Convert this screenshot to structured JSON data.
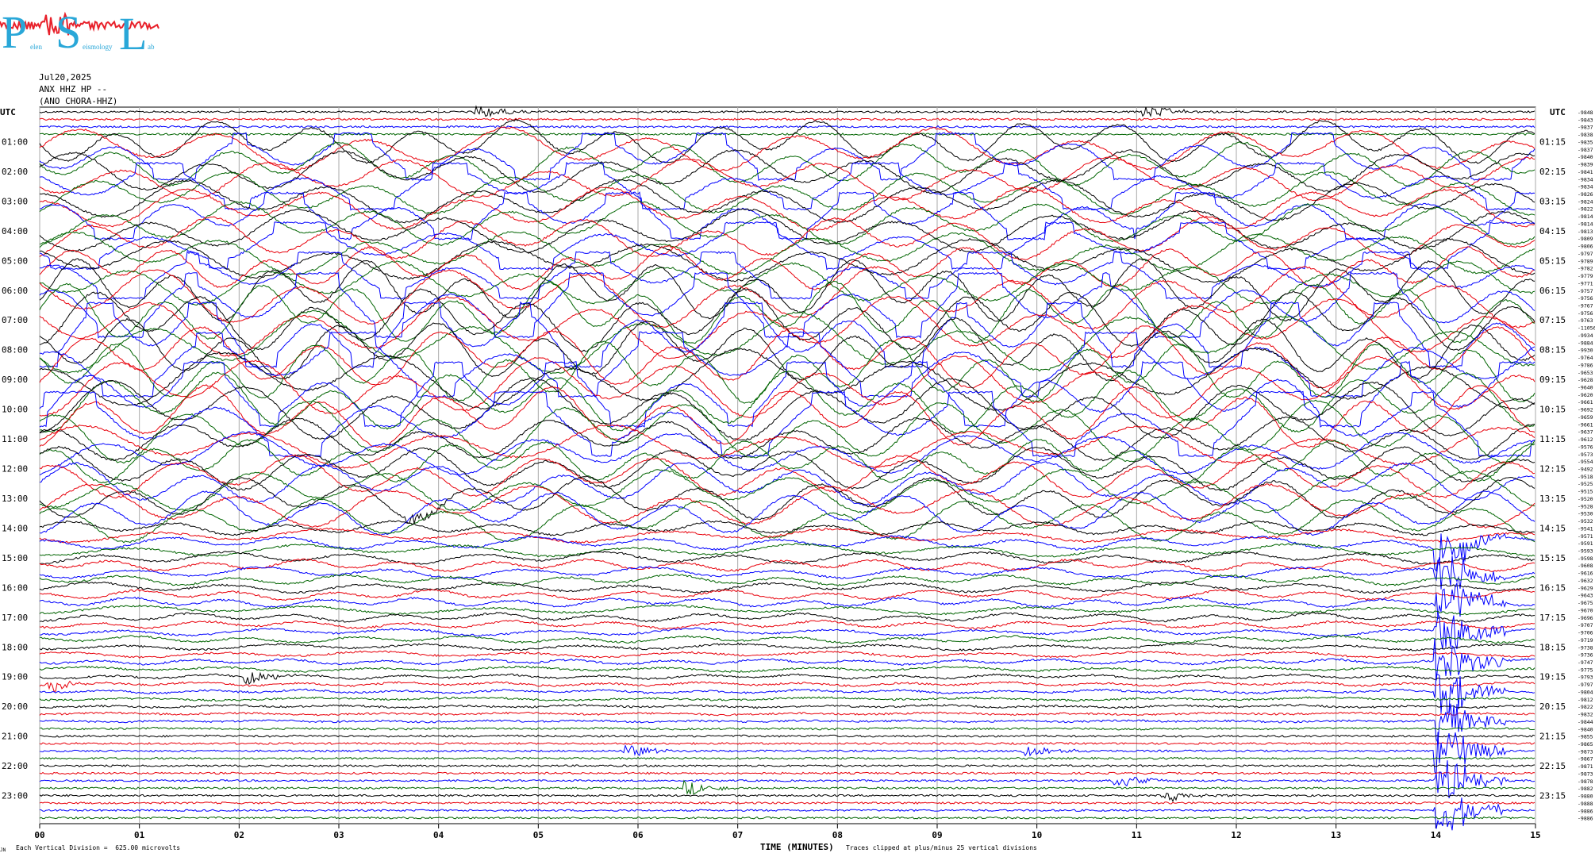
{
  "logo": {
    "initials": [
      "P",
      "S",
      "L"
    ],
    "small_text": [
      "elen",
      "eismology",
      "ab"
    ],
    "colors": {
      "letters": "#29a7d8",
      "trace": "#e8202a"
    }
  },
  "header": {
    "date": "Jul20,2025",
    "station": "ANX HHZ HP --",
    "location": "(ANO CHORA-HHZ)"
  },
  "labels": {
    "utc_left": "UTC",
    "utc_right": "UTC",
    "x_title": "TIME (MINUTES)",
    "scale_note": "Each Vertical Division =  625.00 microvolts",
    "clip_note": "Traces clipped at plus/minus 25 vertical divisions",
    "corner_mark": "JN"
  },
  "chart_data": {
    "type": "line",
    "title": "",
    "xlabel": "TIME (MINUTES)",
    "xlim": [
      0,
      15
    ],
    "x_ticks": [
      "00",
      "01",
      "02",
      "03",
      "04",
      "05",
      "06",
      "07",
      "08",
      "09",
      "10",
      "11",
      "12",
      "13",
      "14",
      "15"
    ],
    "left_hour_labels": [
      "01:00",
      "02:00",
      "03:00",
      "04:00",
      "05:00",
      "06:00",
      "07:00",
      "08:00",
      "09:00",
      "10:00",
      "11:00",
      "12:00",
      "13:00",
      "14:00",
      "15:00",
      "16:00",
      "17:00",
      "18:00",
      "19:00",
      "20:00",
      "21:00",
      "22:00",
      "23:00"
    ],
    "right_hour_labels": [
      "01:15",
      "02:15",
      "03:15",
      "04:15",
      "05:15",
      "06:15",
      "07:15",
      "08:15",
      "09:15",
      "10:15",
      "11:15",
      "12:15",
      "13:15",
      "14:15",
      "15:15",
      "16:15",
      "17:15",
      "18:15",
      "19:15",
      "20:15",
      "21:15",
      "22:15",
      "23:15"
    ],
    "trace_colors": [
      "#000000",
      "#e8000b",
      "#0000ff",
      "#006400"
    ],
    "trace_count": 96,
    "trace_interval_minutes": 15,
    "right_offsets": [
      "-9848",
      "-9843",
      "-9837",
      "-9838",
      "-9835",
      "-9837",
      "-9840",
      "-9839",
      "-9841",
      "-9834",
      "-9834",
      "-9826",
      "-9824",
      "-9822",
      "-9814",
      "-9814",
      "-9813",
      "-9809",
      "-9806",
      "-9797",
      "-9789",
      "-9782",
      "-9779",
      "-9771",
      "-9757",
      "-9756",
      "-9767",
      "-9756",
      "-9763",
      "-11056",
      "-9934",
      "-9884",
      "-9930",
      "-9764",
      "-9786",
      "-9653",
      "-9628",
      "-9640",
      "-9620",
      "-9661",
      "-9692",
      "-9659",
      "-9661",
      "-9637",
      "-9612",
      "-9576",
      "-9573",
      "-9554",
      "-9492",
      "-9518",
      "-9525",
      "-9515",
      "-9520",
      "-9528",
      "-9530",
      "-9532",
      "-9541",
      "-9571",
      "-9591",
      "-9593",
      "-9598",
      "-9608",
      "-9616",
      "-9632",
      "-9629",
      "-9643",
      "-9675",
      "-9670",
      "-9696",
      "-9707",
      "-9706",
      "-9719",
      "-9738",
      "-9736",
      "-9747",
      "-9775",
      "-9793",
      "-9797",
      "-9804",
      "-9812",
      "-9822",
      "-9832",
      "-9844",
      "-9840",
      "-9855",
      "-9865",
      "-9873",
      "-9867",
      "-9871",
      "-9873",
      "-9878",
      "-9882",
      "-9880",
      "-9888",
      "-9886",
      "-9886"
    ],
    "signal": {
      "large_oscillation_hours": [
        "01:00",
        "13:00"
      ],
      "strongest_hours": [
        "06:00",
        "10:00"
      ],
      "blue_burst_minute": 14.0,
      "blue_burst_hours": [
        "14:00",
        "23:00"
      ],
      "small_events": [
        {
          "trace": 0,
          "minute": 4.4
        },
        {
          "trace": 0,
          "minute": 11.1
        },
        {
          "trace": 52,
          "minute": 3.7
        },
        {
          "trace": 77,
          "minute": 0.1
        },
        {
          "trace": 76,
          "minute": 2.1
        },
        {
          "trace": 86,
          "minute": 5.9
        },
        {
          "trace": 86,
          "minute": 9.9
        },
        {
          "trace": 90,
          "minute": 10.8
        },
        {
          "trace": 91,
          "minute": 6.5
        },
        {
          "trace": 92,
          "minute": 11.3
        }
      ]
    }
  }
}
